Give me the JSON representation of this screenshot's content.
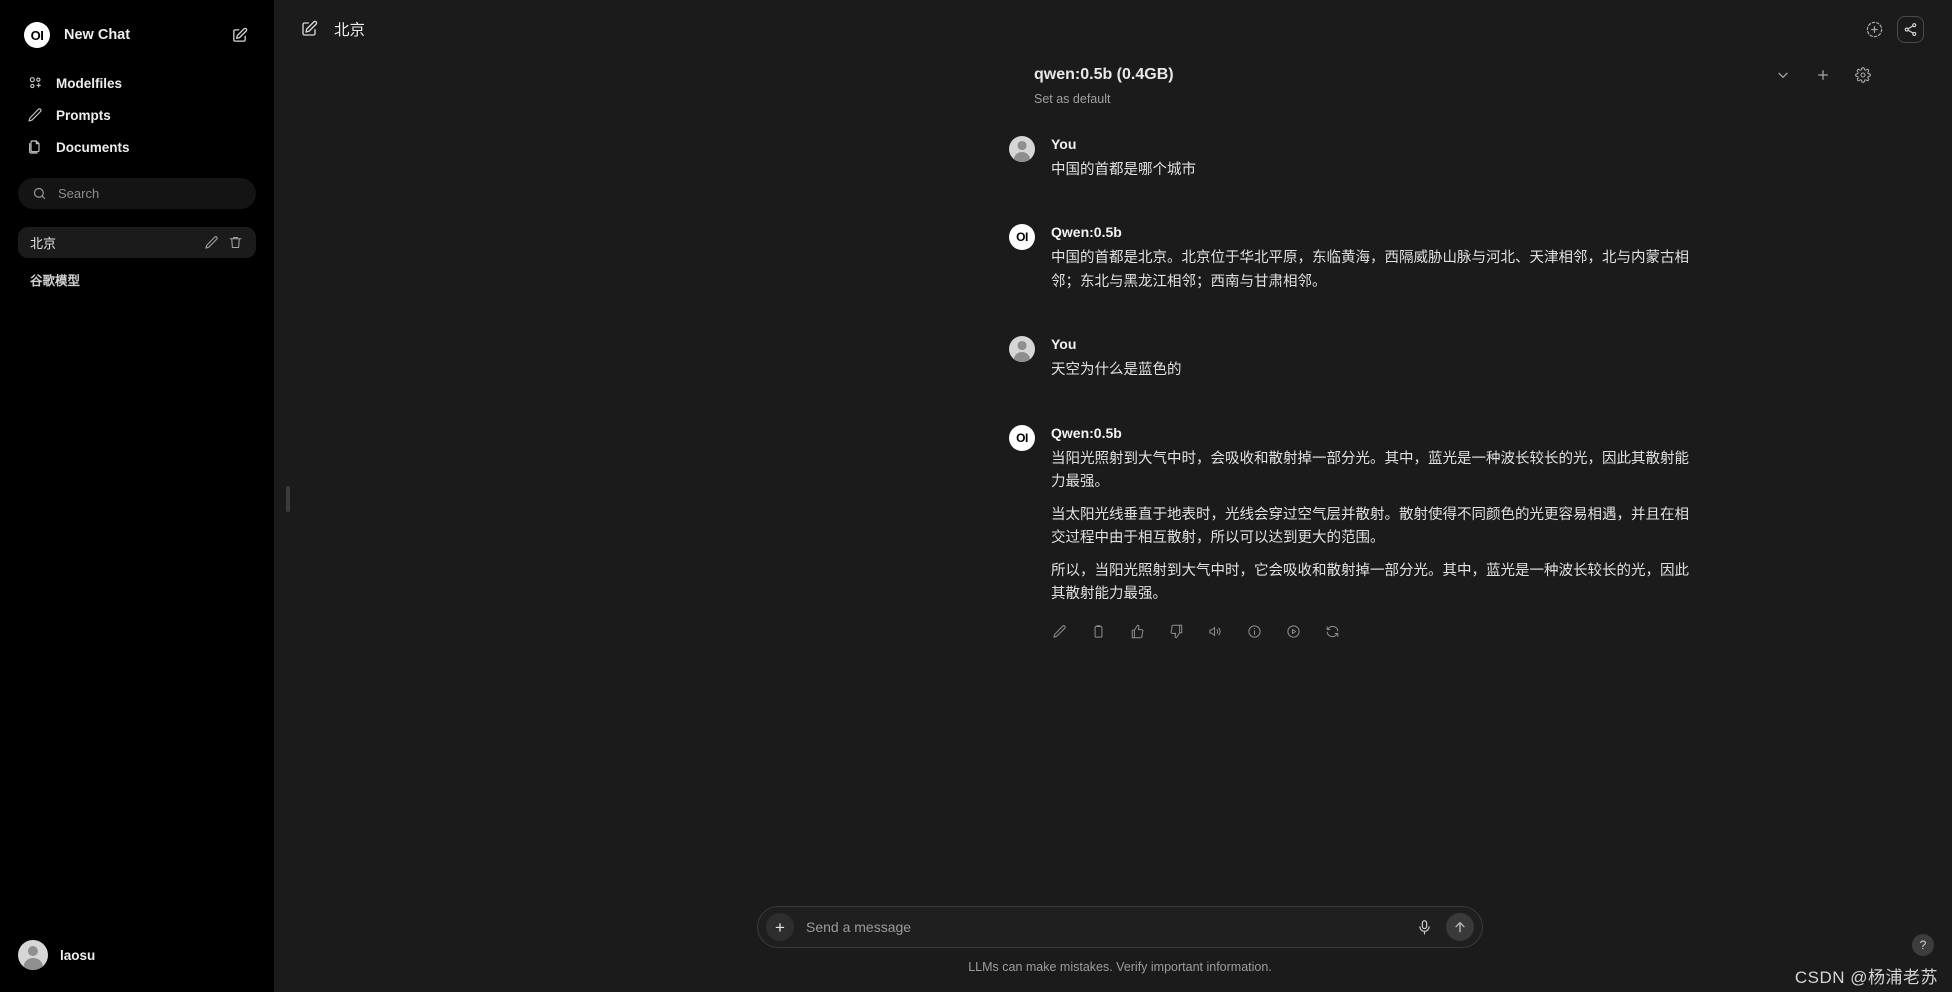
{
  "sidebar": {
    "logo_text": "OI",
    "header_title": "New Chat",
    "new_chat_icon": "pen-square-icon",
    "nav": [
      {
        "label": "Modelfiles",
        "icon": "modelfiles-icon"
      },
      {
        "label": "Prompts",
        "icon": "pencil-icon"
      },
      {
        "label": "Documents",
        "icon": "documents-icon"
      }
    ],
    "search": {
      "placeholder": "Search",
      "value": "",
      "icon": "search-icon"
    },
    "chats": [
      {
        "title": "北京",
        "active": true,
        "edit_icon": "pencil-icon",
        "delete_icon": "trash-icon"
      }
    ],
    "group_label": "谷歌模型",
    "user": {
      "name": "laosu"
    }
  },
  "topbar": {
    "edit_icon": "pen-square-icon",
    "title": "北京",
    "add_icon": "circle-plus-dashed-icon",
    "share_icon": "share-icon"
  },
  "model_row": {
    "name": "qwen:0.5b (0.4GB)",
    "set_default_label": "Set as default",
    "chevron_icon": "chevron-down-icon",
    "plus_icon": "plus-icon",
    "gear_icon": "gear-icon"
  },
  "messages": [
    {
      "role": "user",
      "name": "You",
      "avatar": "user-avatar",
      "paragraphs": [
        "中国的首都是哪个城市"
      ]
    },
    {
      "role": "assistant",
      "name": "Qwen:0.5b",
      "avatar": "oi-avatar",
      "avatar_text": "OI",
      "paragraphs": [
        "中国的首都是北京。北京位于华北平原，东临黄海，西隔威胁山脉与河北、天津相邻，北与内蒙古相邻；东北与黑龙江相邻；西南与甘肃相邻。"
      ]
    },
    {
      "role": "user",
      "name": "You",
      "avatar": "user-avatar",
      "paragraphs": [
        "天空为什么是蓝色的"
      ]
    },
    {
      "role": "assistant",
      "name": "Qwen:0.5b",
      "avatar": "oi-avatar",
      "avatar_text": "OI",
      "paragraphs": [
        "当阳光照射到大气中时，会吸收和散射掉一部分光。其中，蓝光是一种波长较长的光，因此其散射能力最强。",
        "当太阳光线垂直于地表时，光线会穿过空气层并散射。散射使得不同颜色的光更容易相遇，并且在相交过程中由于相互散射，所以可以达到更大的范围。",
        "所以，当阳光照射到大气中时，它会吸收和散射掉一部分光。其中，蓝光是一种波长较长的光，因此其散射能力最强。"
      ],
      "actions": [
        "edit-icon",
        "copy-icon",
        "thumbs-up-icon",
        "thumbs-down-icon",
        "speaker-icon",
        "info-icon",
        "continue-icon",
        "regenerate-icon"
      ]
    }
  ],
  "composer": {
    "plus_label": "+",
    "placeholder": "Send a message",
    "value": "",
    "mic_icon": "microphone-icon",
    "send_icon": "arrow-up-icon"
  },
  "footer": {
    "disclaimer": "LLMs can make mistakes. Verify important information.",
    "help_label": "?",
    "watermark": "CSDN @杨浦老苏"
  },
  "colors": {
    "sidebar_bg": "#000000",
    "main_bg": "#1b1b1b",
    "text_primary": "#ededed",
    "text_muted": "#9b9b9b",
    "active_item_bg": "#1b1b1b"
  }
}
